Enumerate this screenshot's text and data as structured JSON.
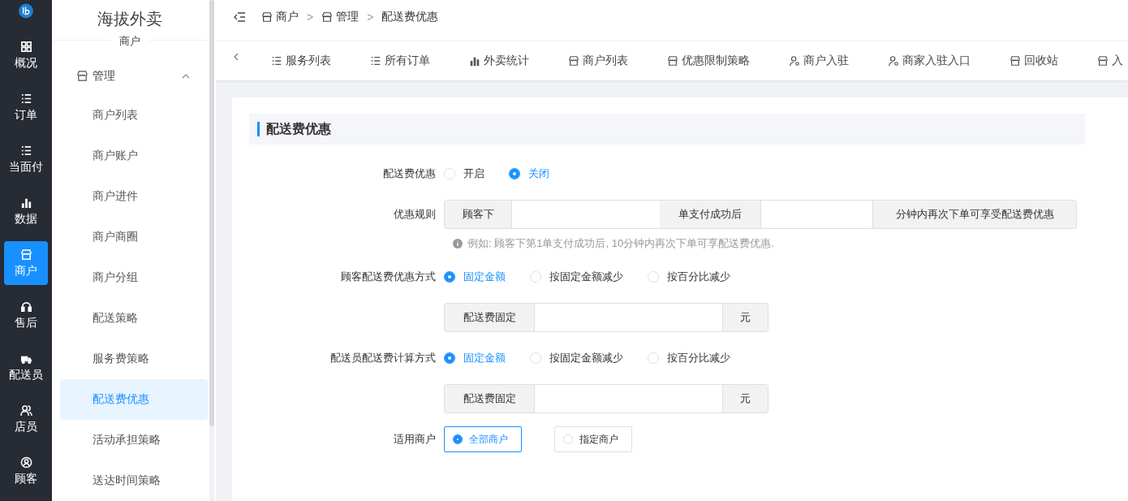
{
  "rail": {
    "items": [
      {
        "label": "概况",
        "selected": false
      },
      {
        "label": "订单",
        "selected": false
      },
      {
        "label": "当面付",
        "selected": false
      },
      {
        "label": "数据",
        "selected": false
      },
      {
        "label": "商户",
        "selected": true
      },
      {
        "label": "售后",
        "selected": false
      },
      {
        "label": "配送员",
        "selected": false
      },
      {
        "label": "店员",
        "selected": false
      },
      {
        "label": "顾客",
        "selected": false
      }
    ]
  },
  "sidebar": {
    "title": "海拔外卖",
    "subtitle": "商户",
    "group": {
      "label": "管理",
      "expanded": true,
      "items": [
        {
          "label": "商户列表",
          "selected": false
        },
        {
          "label": "商户账户",
          "selected": false
        },
        {
          "label": "商户进件",
          "selected": false
        },
        {
          "label": "商户商圈",
          "selected": false
        },
        {
          "label": "商户分组",
          "selected": false
        },
        {
          "label": "配送策略",
          "selected": false
        },
        {
          "label": "服务费策略",
          "selected": false
        },
        {
          "label": "配送费优惠",
          "selected": true
        },
        {
          "label": "活动承担策略",
          "selected": false
        },
        {
          "label": "送达时间策略",
          "selected": false
        }
      ]
    }
  },
  "breadcrumb": [
    {
      "label": "商户"
    },
    {
      "separator": ">",
      "label": "管理"
    },
    {
      "separator": ">",
      "label": "配送费优惠"
    }
  ],
  "tabs": [
    {
      "label": "服务列表"
    },
    {
      "label": "所有订单"
    },
    {
      "label": "外卖统计"
    },
    {
      "label": "商户列表"
    },
    {
      "label": "优惠限制策略"
    },
    {
      "label": "商户入驻"
    },
    {
      "label": "商家入驻入口"
    },
    {
      "label": "回收站"
    },
    {
      "label": "入"
    }
  ],
  "section_title": "配送费优惠",
  "form": {
    "discount": {
      "label": "配送费优惠",
      "options": [
        {
          "label": "开启",
          "selected": false
        },
        {
          "label": "关闭",
          "selected": true
        }
      ]
    },
    "rule": {
      "label": "优惠规则",
      "parts": [
        {
          "kind": "addon",
          "text": "顾客下"
        },
        {
          "kind": "input"
        },
        {
          "kind": "addon",
          "text": "单支付成功后"
        },
        {
          "kind": "input"
        },
        {
          "kind": "addon",
          "text": "分钟内再次下单可享受配送费优惠"
        }
      ],
      "hint": "例如: 顾客下第1单支付成功后, 10分钟内再次下单可享配送费优惠."
    },
    "customer_method": {
      "label": "顾客配送费优惠方式",
      "options": [
        {
          "label": "固定金额",
          "selected": true
        },
        {
          "label": "按固定金额减少",
          "selected": false
        },
        {
          "label": "按百分比减少",
          "selected": false
        }
      ],
      "field": {
        "prefix": "配送费固定",
        "suffix": "元"
      }
    },
    "courier_method": {
      "label": "配送员配送费计算方式",
      "options": [
        {
          "label": "固定金额",
          "selected": true
        },
        {
          "label": "按固定金额减少",
          "selected": false
        },
        {
          "label": "按百分比减少",
          "selected": false
        }
      ],
      "field": {
        "prefix": "配送费固定",
        "suffix": "元"
      }
    },
    "merchants": {
      "label": "适用商户",
      "options": [
        {
          "label": "全部商户",
          "selected": true
        },
        {
          "label": "指定商户",
          "selected": false
        }
      ]
    }
  }
}
